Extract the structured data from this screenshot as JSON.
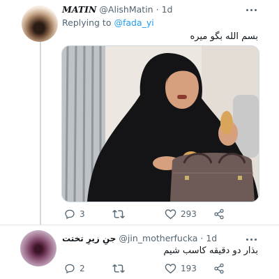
{
  "tweets": [
    {
      "display_name": "MATIN",
      "handle": "@AlishMatin",
      "separator": "·",
      "time": "1d",
      "replying_prefix": "Replying to",
      "replying_to": "@fada_yi",
      "text": "بسم الله بگو میره",
      "media_present": true,
      "replies": "3",
      "retweets": "",
      "likes": "293"
    },
    {
      "display_name": "جنِ زیرِ تختت",
      "handle": "@jin_motherfucka",
      "separator": "·",
      "time": "1d",
      "text": "بذار دو دقیقه کاسب شیم",
      "replies": "2",
      "retweets": "",
      "likes": "193"
    }
  ],
  "icons": {
    "reply": "reply-icon",
    "retweet": "retweet-icon",
    "like": "heart-icon",
    "share": "share-icon",
    "more": "more-options-icon"
  },
  "colors": {
    "link": "#1d9bf0",
    "secondary_text": "#536471",
    "divider": "#e1e8ed"
  }
}
